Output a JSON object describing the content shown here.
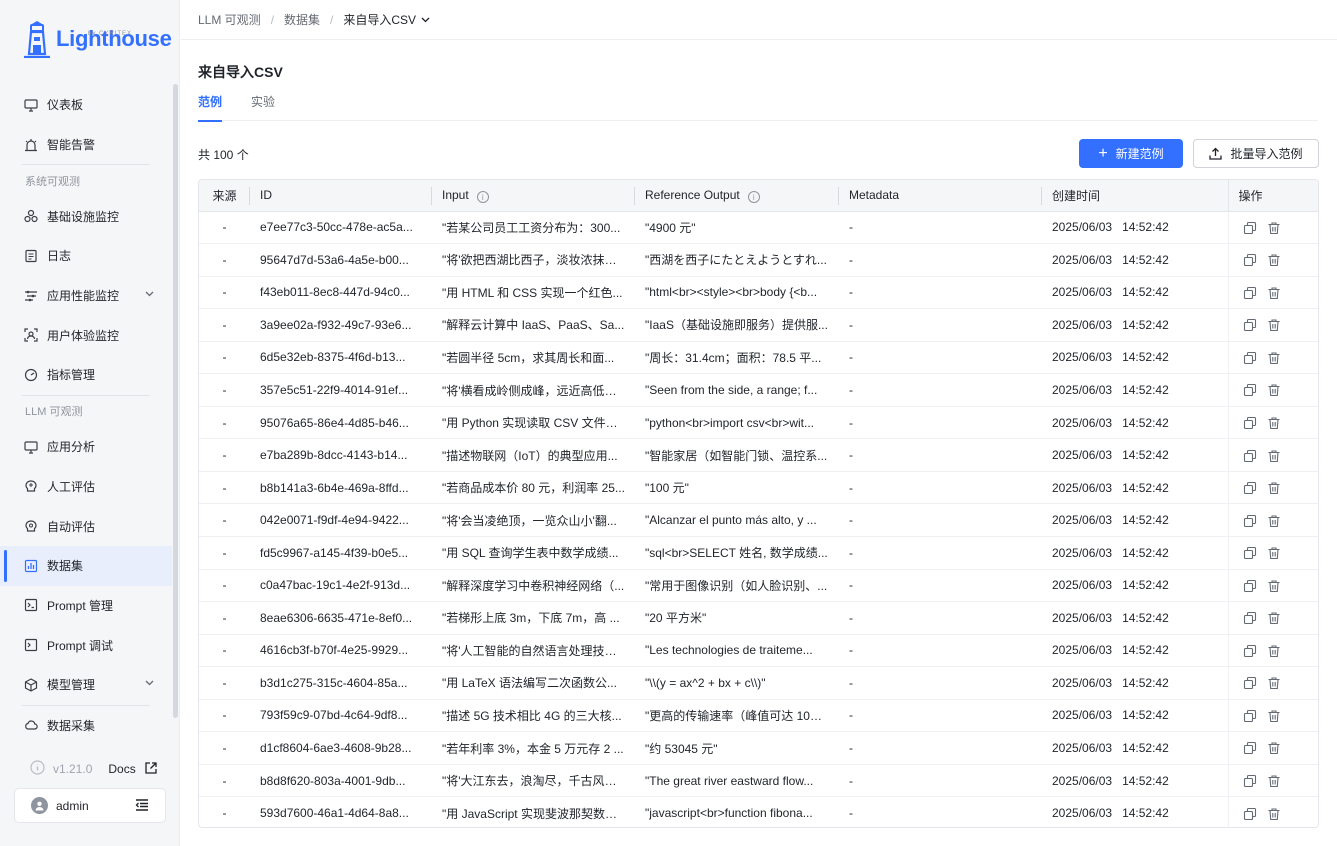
{
  "sidebar": {
    "logo_text": "Lighthouse",
    "logo_sub": "by CYRITEX",
    "items_top": [
      {
        "label": "仪表板",
        "icon": "monitor-icon"
      },
      {
        "label": "智能告警",
        "icon": "alarm-icon"
      }
    ],
    "group1": "系统可观测",
    "items_sys": [
      {
        "label": "基础设施监控",
        "icon": "cluster-icon"
      },
      {
        "label": "日志",
        "icon": "log-icon"
      },
      {
        "label": "应用性能监控",
        "icon": "filter-icon"
      },
      {
        "label": "用户体验监控",
        "icon": "user-scan-icon"
      },
      {
        "label": "指标管理",
        "icon": "gauge-icon"
      }
    ],
    "group2": "LLM 可观测",
    "items_llm": [
      {
        "label": "应用分析",
        "icon": "monitor-icon"
      },
      {
        "label": "人工评估",
        "icon": "brain-icon"
      },
      {
        "label": "自动评估",
        "icon": "brain-icon"
      },
      {
        "label": "数据集",
        "icon": "chart-icon"
      },
      {
        "label": "Prompt 管理",
        "icon": "prompt-icon"
      },
      {
        "label": "Prompt 调试",
        "icon": "prompt-debug-icon"
      },
      {
        "label": "模型管理",
        "icon": "cube-icon"
      }
    ],
    "items_bottom": [
      {
        "label": "数据采集",
        "icon": "cloud-icon"
      }
    ],
    "version": "v1.21.0",
    "docs": "Docs",
    "user": "admin"
  },
  "breadcrumb": [
    "LLM 可观测",
    "数据集",
    "来自导入CSV"
  ],
  "page_title": "来自导入CSV",
  "tabs": [
    "范例",
    "实验"
  ],
  "total": "共 100 个",
  "buttons": {
    "new": "新建范例",
    "import": "批量导入范例"
  },
  "table": {
    "headers": {
      "source": "来源",
      "id": "ID",
      "input": "Input",
      "reference": "Reference Output",
      "metadata": "Metadata",
      "created": "创建时间",
      "ops": "操作"
    },
    "rows": [
      {
        "source": "-",
        "id": "e7ee77c3-50cc-478e-ac5a...",
        "input": "\"若某公司员工工资分布为：300...",
        "output": "\"4900 元\"",
        "meta": "-",
        "date": "2025/06/03",
        "time": "14:52:42"
      },
      {
        "source": "-",
        "id": "95647d7d-53a6-4a5e-b00...",
        "input": "\"将'欲把西湖比西子，淡妆浓抹总...",
        "output": "\"西湖を西子にたとえようとすれ...",
        "meta": "-",
        "date": "2025/06/03",
        "time": "14:52:42"
      },
      {
        "source": "-",
        "id": "f43eb011-8ec8-447d-94c0...",
        "input": "\"用 HTML 和 CSS 实现一个红色...",
        "output": "\"html<br><style><br>body {<b...",
        "meta": "-",
        "date": "2025/06/03",
        "time": "14:52:42"
      },
      {
        "source": "-",
        "id": "3a9ee02a-f932-49c7-93e6...",
        "input": "\"解释云计算中 IaaS、PaaS、Sa...",
        "output": "\"IaaS（基础设施即服务）提供服...",
        "meta": "-",
        "date": "2025/06/03",
        "time": "14:52:42"
      },
      {
        "source": "-",
        "id": "6d5e32eb-8375-4f6d-b13...",
        "input": "\"若圆半径 5cm，求其周长和面...",
        "output": "\"周长：31.4cm；面积：78.5 平...",
        "meta": "-",
        "date": "2025/06/03",
        "time": "14:52:42"
      },
      {
        "source": "-",
        "id": "357e5c51-22f9-4014-91ef...",
        "input": "\"将'横看成岭侧成峰，远近高低各...",
        "output": "\"Seen from the side, a range; f...",
        "meta": "-",
        "date": "2025/06/03",
        "time": "14:52:42"
      },
      {
        "source": "-",
        "id": "95076a65-86e4-4d85-b46...",
        "input": "\"用 Python 实现读取 CSV 文件并...",
        "output": "\"python<br>import csv<br>wit...",
        "meta": "-",
        "date": "2025/06/03",
        "time": "14:52:42"
      },
      {
        "source": "-",
        "id": "e7ba289b-8dcc-4143-b14...",
        "input": "\"描述物联网（IoT）的典型应用...",
        "output": "\"智能家居（如智能门锁、温控系...",
        "meta": "-",
        "date": "2025/06/03",
        "time": "14:52:42"
      },
      {
        "source": "-",
        "id": "b8b141a3-6b4e-469a-8ffd...",
        "input": "\"若商品成本价 80 元，利润率 25...",
        "output": "\"100 元\"",
        "meta": "-",
        "date": "2025/06/03",
        "time": "14:52:42"
      },
      {
        "source": "-",
        "id": "042e0071-f9df-4e94-9422...",
        "input": "\"将'会当凌绝顶，一览众山小'翻...",
        "output": "\"Alcanzar el punto más alto, y ...",
        "meta": "-",
        "date": "2025/06/03",
        "time": "14:52:42"
      },
      {
        "source": "-",
        "id": "fd5c9967-a145-4f39-b0e5...",
        "input": "\"用 SQL 查询学生表中数学成绩...",
        "output": "\"sql<br>SELECT 姓名, 数学成绩...",
        "meta": "-",
        "date": "2025/06/03",
        "time": "14:52:42"
      },
      {
        "source": "-",
        "id": "c0a47bac-19c1-4e2f-913d...",
        "input": "\"解释深度学习中卷积神经网络（...",
        "output": "\"常用于图像识别（如人脸识别、...",
        "meta": "-",
        "date": "2025/06/03",
        "time": "14:52:42"
      },
      {
        "source": "-",
        "id": "8eae6306-6635-471e-8ef0...",
        "input": "\"若梯形上底 3m，下底 7m，高 ...",
        "output": "\"20 平方米\"",
        "meta": "-",
        "date": "2025/06/03",
        "time": "14:52:42"
      },
      {
        "source": "-",
        "id": "4616cb3f-b70f-4e25-9929...",
        "input": "\"将'人工智能的自然语言处理技术...",
        "output": "\"Les technologies de traiteme...",
        "meta": "-",
        "date": "2025/06/03",
        "time": "14:52:42"
      },
      {
        "source": "-",
        "id": "b3d1c275-315c-4604-85a...",
        "input": "\"用 LaTeX 语法编写二次函数公...",
        "output": "\"\\\\(y = ax^2 + bx + c\\\\)\"",
        "meta": "-",
        "date": "2025/06/03",
        "time": "14:52:42"
      },
      {
        "source": "-",
        "id": "793f59c9-07bd-4c64-9df8...",
        "input": "\"描述 5G 技术相比 4G 的三大核...",
        "output": "\"更高的传输速率（峰值可达 10G...",
        "meta": "-",
        "date": "2025/06/03",
        "time": "14:52:42"
      },
      {
        "source": "-",
        "id": "d1cf8604-6ae3-4608-9b28...",
        "input": "\"若年利率 3%，本金 5 万元存 2 ...",
        "output": "\"约 53045 元\"",
        "meta": "-",
        "date": "2025/06/03",
        "time": "14:52:42"
      },
      {
        "source": "-",
        "id": "b8d8f620-803a-4001-9db...",
        "input": "\"将'大江东去，浪淘尽，千古风流...",
        "output": "\"The great river eastward flow...",
        "meta": "-",
        "date": "2025/06/03",
        "time": "14:52:42"
      },
      {
        "source": "-",
        "id": "593d7600-46a1-4d64-8a8...",
        "input": "\"用 JavaScript 实现斐波那契数列...",
        "output": "\"javascript<br>function fibona...",
        "meta": "-",
        "date": "2025/06/03",
        "time": "14:52:42"
      }
    ]
  },
  "colors": {
    "accent": "#3370ff",
    "sidebar_bg": "#f5f6f8"
  }
}
